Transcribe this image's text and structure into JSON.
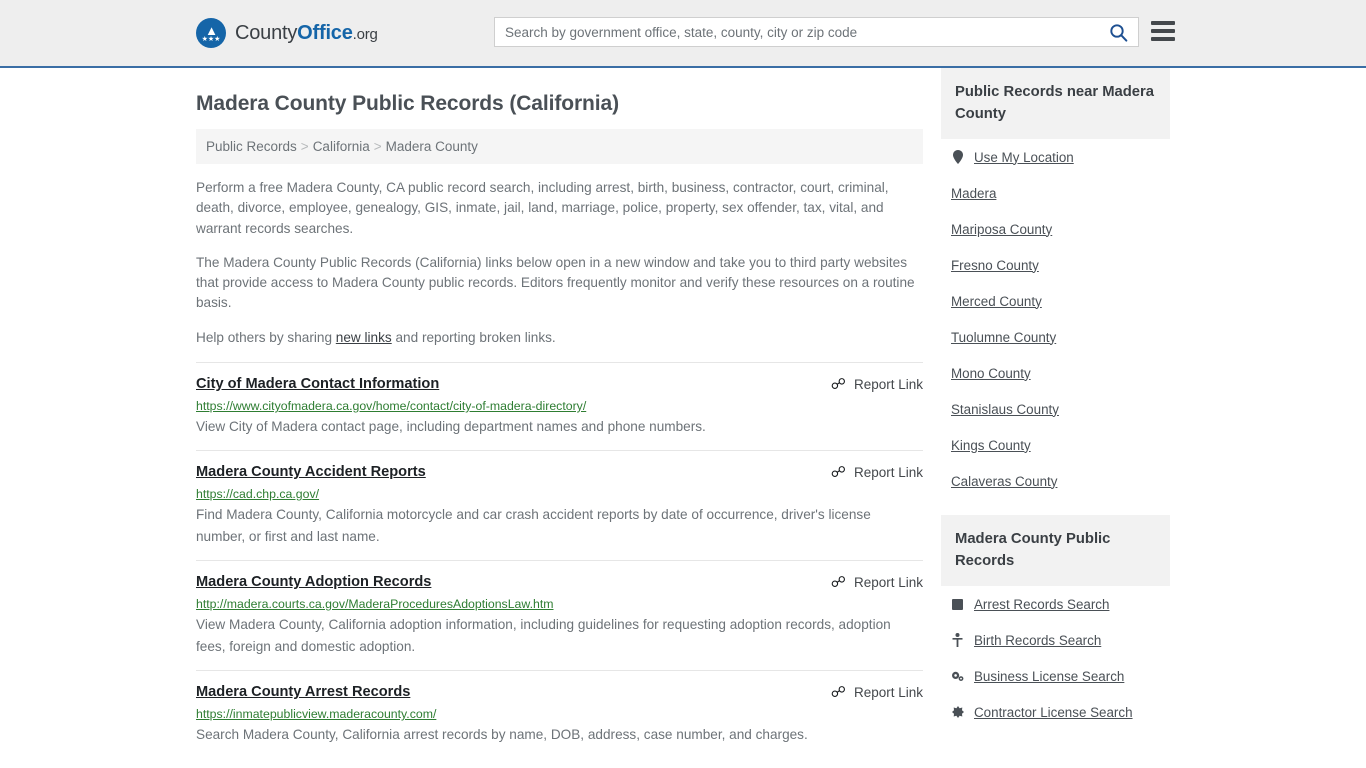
{
  "header": {
    "brand": {
      "part1": "County",
      "part2": "Office",
      "part3": ".org",
      "logo_icon": "eagle-seal-icon"
    },
    "search": {
      "placeholder": "Search by government office, state, county, city or zip code",
      "value": "",
      "button_icon": "search-icon"
    },
    "menu_icon": "hamburger-menu-icon",
    "accent_color": "#1565a8",
    "border_color": "#3a6ea5"
  },
  "page": {
    "title": "Madera County Public Records (California)",
    "breadcrumb": [
      {
        "label": "Public Records"
      },
      {
        "label": "California"
      },
      {
        "label": "Madera County"
      }
    ],
    "breadcrumb_separator": ">",
    "intro_1": "Perform a free Madera County, CA public record search, including arrest, birth, business, contractor, court, criminal, death, divorce, employee, genealogy, GIS, inmate, jail, land, marriage, police, property, sex offender, tax, vital, and warrant records searches.",
    "intro_2": "The Madera County Public Records (California) links below open in a new window and take you to third party websites that provide access to Madera County public records. Editors frequently monitor and verify these resources on a routine basis.",
    "intro_3_before": "Help others by sharing ",
    "intro_3_link": "new links",
    "intro_3_after": " and reporting broken links."
  },
  "report_link": {
    "label": "Report Link",
    "icon": "broken-link-icon",
    "glyph": "⛓"
  },
  "results": [
    {
      "title": "City of Madera Contact Information",
      "url": "https://www.cityofmadera.ca.gov/home/contact/city-of-madera-directory/",
      "description": "View City of Madera contact page, including department names and phone numbers."
    },
    {
      "title": "Madera County Accident Reports",
      "url": "https://cad.chp.ca.gov/",
      "description": "Find Madera County, California motorcycle and car crash accident reports by date of occurrence, driver's license number, or first and last name."
    },
    {
      "title": "Madera County Adoption Records",
      "url": "http://madera.courts.ca.gov/MaderaProceduresAdoptionsLaw.htm",
      "description": "View Madera County, California adoption information, including guidelines for requesting adoption records, adoption fees, foreign and domestic adoption."
    },
    {
      "title": "Madera County Arrest Records",
      "url": "https://inmatepublicview.maderacounty.com/",
      "description": "Search Madera County, California arrest records by name, DOB, address, case number, and charges."
    }
  ],
  "sidebar": {
    "near": {
      "heading": "Public Records near Madera County",
      "items": [
        {
          "label": "Use My Location",
          "icon": "map-pin-icon"
        },
        {
          "label": "Madera",
          "icon": ""
        },
        {
          "label": "Mariposa County",
          "icon": ""
        },
        {
          "label": "Fresno County",
          "icon": ""
        },
        {
          "label": "Merced County",
          "icon": ""
        },
        {
          "label": "Tuolumne County",
          "icon": ""
        },
        {
          "label": "Mono County",
          "icon": ""
        },
        {
          "label": "Stanislaus County",
          "icon": ""
        },
        {
          "label": "Kings County",
          "icon": ""
        },
        {
          "label": "Calaveras County",
          "icon": ""
        }
      ]
    },
    "records": {
      "heading": "Madera County Public Records",
      "items": [
        {
          "label": "Arrest Records Search",
          "icon": "handcuffs-icon",
          "glyph": "■"
        },
        {
          "label": "Birth Records Search",
          "icon": "baby-icon",
          "glyph": "⍟"
        },
        {
          "label": "Business License Search",
          "icon": "gears-icon",
          "glyph": "⚙"
        },
        {
          "label": "Contractor License Search",
          "icon": "hard-hat-icon",
          "glyph": "✿"
        }
      ]
    }
  }
}
